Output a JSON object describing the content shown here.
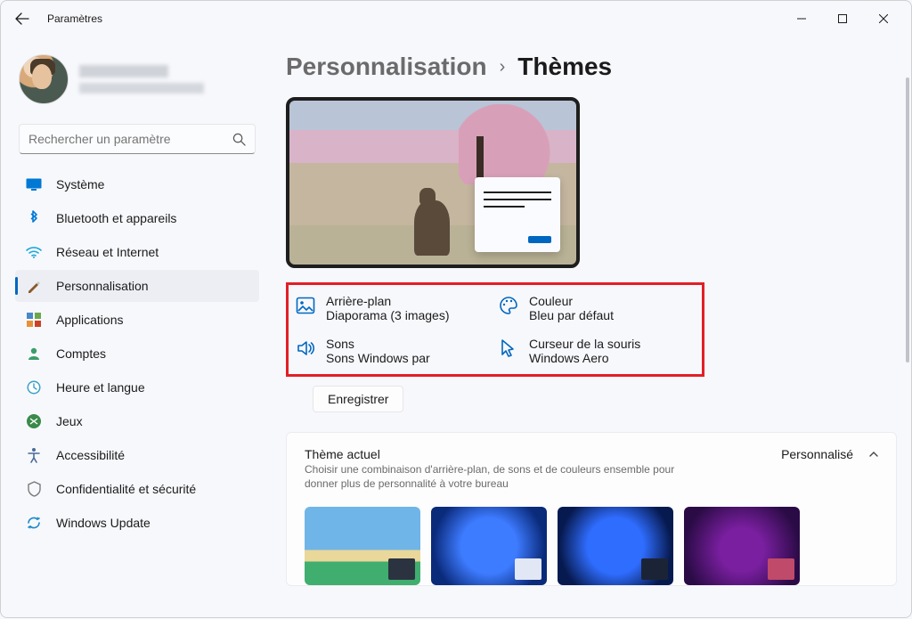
{
  "window": {
    "title": "Paramètres"
  },
  "account": {
    "name": "",
    "email": ""
  },
  "search": {
    "placeholder": "Rechercher un paramètre"
  },
  "nav": [
    {
      "label": "Système",
      "icon": "system"
    },
    {
      "label": "Bluetooth et appareils",
      "icon": "bluetooth"
    },
    {
      "label": "Réseau et Internet",
      "icon": "network"
    },
    {
      "label": "Personnalisation",
      "icon": "personalization",
      "selected": true
    },
    {
      "label": "Applications",
      "icon": "apps"
    },
    {
      "label": "Comptes",
      "icon": "accounts"
    },
    {
      "label": "Heure et langue",
      "icon": "time"
    },
    {
      "label": "Jeux",
      "icon": "gaming"
    },
    {
      "label": "Accessibilité",
      "icon": "accessibility"
    },
    {
      "label": "Confidentialité et sécurité",
      "icon": "privacy"
    },
    {
      "label": "Windows Update",
      "icon": "update"
    }
  ],
  "breadcrumb": {
    "parent": "Personnalisation",
    "current": "Thèmes"
  },
  "theme_props": {
    "background": {
      "title": "Arrière-plan",
      "value": "Diaporama (3 images)"
    },
    "color": {
      "title": "Couleur",
      "value": "Bleu par défaut"
    },
    "sounds": {
      "title": "Sons",
      "value": "Sons Windows par"
    },
    "cursor": {
      "title": "Curseur de la souris",
      "value": "Windows Aero"
    }
  },
  "save_button": "Enregistrer",
  "current_theme": {
    "title": "Thème actuel",
    "description": "Choisir une combinaison d'arrière-plan, de sons et de couleurs ensemble pour donner plus de personnalité à votre bureau",
    "value": "Personnalisé"
  },
  "colors": {
    "accent": "#0067c0",
    "highlight_box": "#e21f26"
  }
}
